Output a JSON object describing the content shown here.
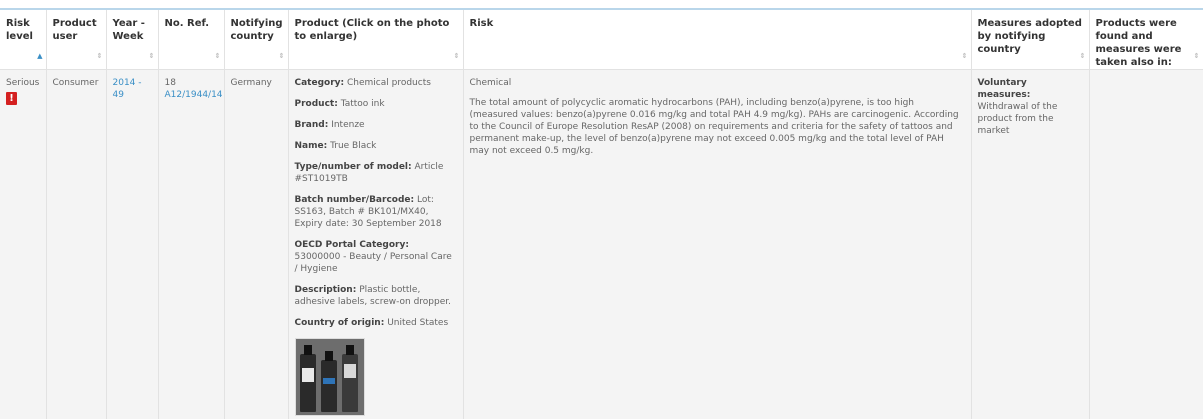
{
  "headers": {
    "risk_level": "Risk level",
    "product_user": "Product user",
    "year_week": "Year - Week",
    "no_ref": "No. Ref.",
    "notifying_country": "Notifying country",
    "product": "Product (Click on the photo to enlarge)",
    "risk": "Risk",
    "measures": "Measures adopted by notifying country",
    "products_found": "Products were found and measures were taken also in:"
  },
  "row": {
    "risk_level": "Serious",
    "product_user": "Consumer",
    "year_week": "2014 - 49",
    "no_ref_num": "18",
    "no_ref_code": "A12/1944/14",
    "notifying_country": "Germany",
    "product": {
      "category_label": "Category:",
      "category": "Chemical products",
      "product_label": "Product:",
      "product": "Tattoo ink",
      "brand_label": "Brand:",
      "brand": "Intenze",
      "name_label": "Name:",
      "name": "True Black",
      "model_label": "Type/number of model:",
      "model": "Article #ST1019TB",
      "batch_label": "Batch number/Barcode:",
      "batch": "Lot: SS163, Batch # BK101/MX40, Expiry date: 30 September 2018",
      "oecd_label": "OECD Portal Category:",
      "oecd": "53000000 - Beauty / Personal Care / Hygiene",
      "description_label": "Description:",
      "description": "Plastic bottle, adhesive labels, screw-on dropper.",
      "origin_label": "Country of origin:",
      "origin": "United States"
    },
    "risk_type": "Chemical",
    "risk_text": "The total amount of polycyclic aromatic hydrocarbons (PAH), including benzo(a)pyrene, is too high (measured values: benzo(a)pyrene 0.016 mg/kg and total PAH 4.9 mg/kg). PAHs are carcinogenic. According to the Council of Europe Resolution ResAP (2008) on requirements and criteria for the safety of tattoos and permanent make-up, the level of benzo(a)pyrene may not exceed 0.005 mg/kg and the total level of PAH may not exceed 0.5 mg/kg.",
    "measures_label": "Voluntary measures:",
    "measures": "Withdrawal of the product from the market",
    "products_found": ""
  },
  "icons": {
    "sort_active": "sort-ascending-icon",
    "sort": "sort-icon",
    "warning": "warning-icon"
  },
  "colors": {
    "link": "#3a8fc6",
    "warning": "#d42020",
    "row_bg": "#f4f4f4"
  }
}
